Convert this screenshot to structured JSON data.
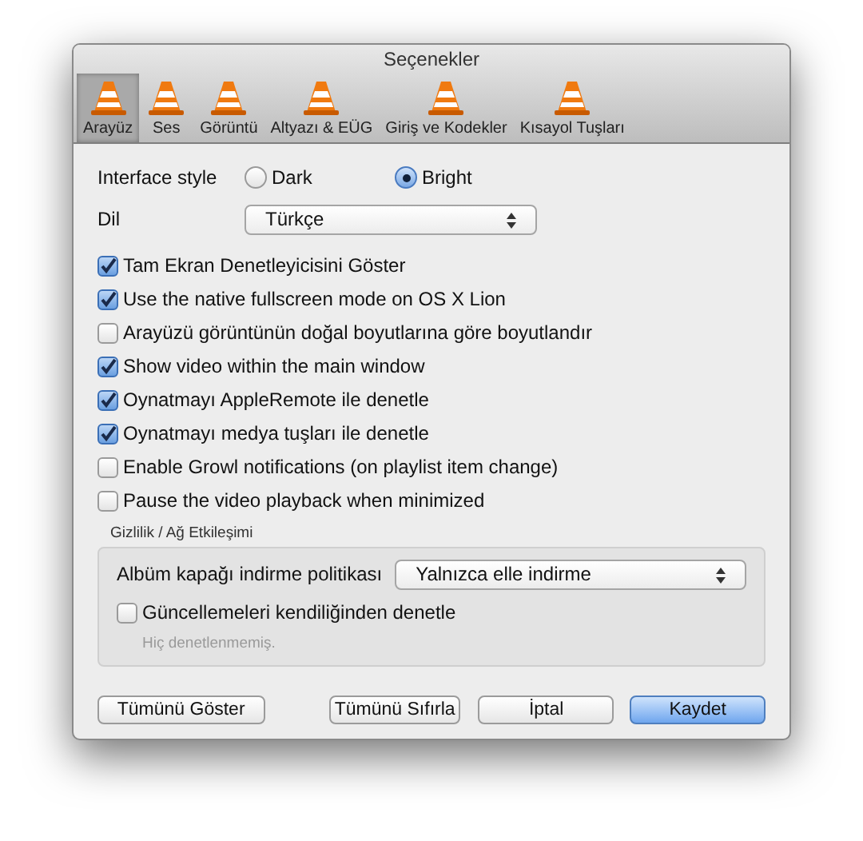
{
  "window": {
    "title": "Seçenekler"
  },
  "toolbar": {
    "items": [
      {
        "label": "Arayüz",
        "selected": true
      },
      {
        "label": "Ses",
        "selected": false
      },
      {
        "label": "Görüntü",
        "selected": false
      },
      {
        "label": "Altyazı & EÜG",
        "selected": false
      },
      {
        "label": "Giriş ve Kodekler",
        "selected": false
      },
      {
        "label": "Kısayol Tuşları",
        "selected": false
      }
    ]
  },
  "interface_style": {
    "label": "Interface style",
    "options": [
      {
        "label": "Dark",
        "selected": false
      },
      {
        "label": "Bright",
        "selected": true
      }
    ]
  },
  "language": {
    "label": "Dil",
    "value": "Türkçe"
  },
  "checkboxes": [
    {
      "label": "Tam Ekran Denetleyicisini Göster",
      "checked": true
    },
    {
      "label": "Use the native fullscreen mode on OS X Lion",
      "checked": true
    },
    {
      "label": "Arayüzü görüntünün doğal boyutlarına göre boyutlandır",
      "checked": false
    },
    {
      "label": "Show video within the main window",
      "checked": true
    },
    {
      "label": "Oynatmayı AppleRemote ile denetle",
      "checked": true
    },
    {
      "label": "Oynatmayı medya tuşları ile denetle",
      "checked": true
    },
    {
      "label": "Enable Growl notifications (on playlist item change)",
      "checked": false
    },
    {
      "label": "Pause the video playback when minimized",
      "checked": false
    }
  ],
  "privacy": {
    "title": "Gizlilik / Ağ Etkileşimi",
    "album_art": {
      "label": "Albüm kapağı indirme politikası",
      "value": "Yalnızca elle indirme"
    },
    "updates": {
      "label": "Güncellemeleri kendiliğinden denetle",
      "checked": false
    },
    "last_check": "Hiç denetlenmemiş."
  },
  "buttons": [
    {
      "label": "Tümünü Göster",
      "kind": "normal"
    },
    {
      "label": "Tümünü Sıfırla",
      "kind": "normal"
    },
    {
      "label": "İptal",
      "kind": "normal"
    },
    {
      "label": "Kaydet",
      "kind": "default"
    }
  ]
}
